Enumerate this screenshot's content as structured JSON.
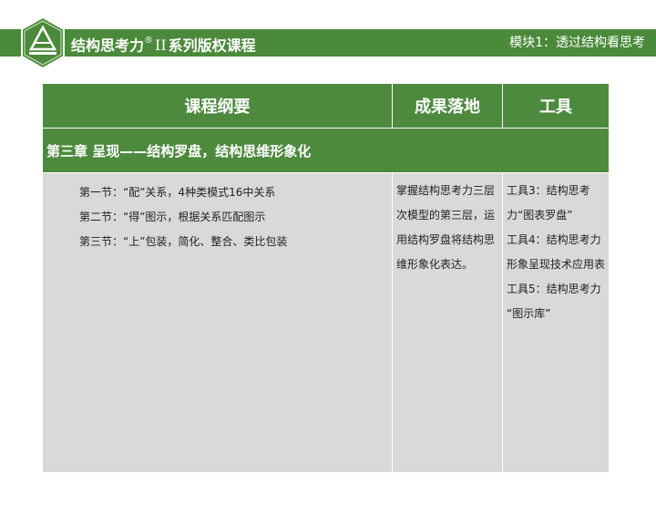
{
  "header": {
    "title_main": "结构思考力",
    "title_reg": "®",
    "title_roman": "II",
    "title_tail": "系列版权课程",
    "module": "模块1：透过结构看思考"
  },
  "table": {
    "col_outline": "课程纲要",
    "col_result": "成果落地",
    "col_tools": "工具",
    "chapter": "第三章  呈现——结构罗盘，结构思维形象化",
    "sections": [
      "第一节：“配”关系，4种类模式16中关系",
      "第二节：“得”图示，根据关系匹配图示",
      "第三节：“上”包装，简化、整合、类比包装"
    ],
    "result": "掌握结构思考力三层次模型的第三层，运用结构罗盘将结构思维形象化表达。",
    "tools": [
      "工具3：结构思考力“图表罗盘”",
      "工具4：结构思考力形象呈现技术应用表",
      "工具5：结构思考力 “图示库”"
    ]
  },
  "colors": {
    "brand_green": "#4a8a3a",
    "cell_gray": "#d9d9d9"
  },
  "icons": {
    "logo": "pyramid-logo-icon"
  }
}
